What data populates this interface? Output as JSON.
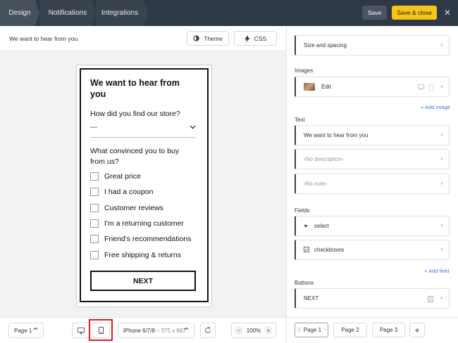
{
  "topbar": {
    "tabs": [
      "Design",
      "Notifications",
      "Integrations"
    ],
    "save_label": "Save",
    "save_close_label": "Save & close",
    "close_glyph": "✕"
  },
  "canvas": {
    "title": "We want to hear from you",
    "theme_label": "Theme",
    "css_label": "CSS"
  },
  "survey": {
    "title": "We want to hear from you",
    "question1": "How did you find our store?",
    "select_value": "---",
    "question2": "What convinced you to buy from us?",
    "options": [
      "Great price",
      "I had a coupon",
      "Customer reviews",
      "I'm a returning customer",
      "Friend's recommendations",
      "Free shipping & returns"
    ],
    "next_label": "NEXT"
  },
  "bottombar": {
    "page_select": "Page 1",
    "device_name": "iPhone 6/7/8",
    "device_dims": "– 375 x 667",
    "zoom": "100%",
    "zoom_minus": "−",
    "zoom_plus": "+"
  },
  "panel": {
    "size_spacing": "Size and spacing",
    "images_label": "Images",
    "image_edit": "Edit",
    "add_image": "+ Add image",
    "text_label": "Text",
    "text_title": "We want to hear from you",
    "text_description": "‹No description›",
    "text_note": "‹No note›",
    "fields_label": "Fields",
    "field_select": "select",
    "field_checkboxes": "checkboxes",
    "add_field": "+ Add field",
    "buttons_label": "Buttons",
    "button_next": "NEXT",
    "pages": [
      "Page 1",
      "Page 2",
      "Page 3"
    ],
    "add_page": "+"
  },
  "colors": {
    "topbar": "#2f3845",
    "accent_yellow": "#f5c518",
    "link_blue": "#3b7be0",
    "highlight_red": "#e21b1b"
  }
}
